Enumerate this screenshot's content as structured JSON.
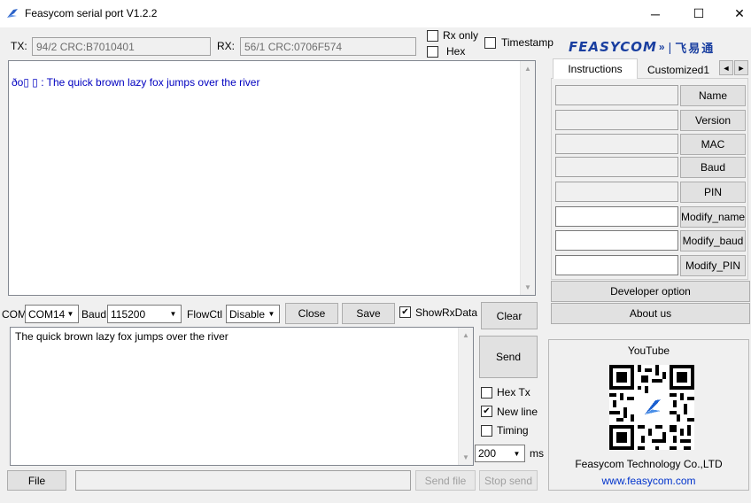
{
  "window": {
    "title": "Feasycom serial port V1.2.2",
    "minimize": "─",
    "maximize": "☐",
    "close": "✕"
  },
  "status": {
    "tx_label": "TX:",
    "tx_value": "94/2 CRC:B7010401",
    "rx_label": "RX:",
    "rx_value": "56/1 CRC:0706F574",
    "rx_only": "Rx only",
    "hex": "Hex",
    "timestamp": "Timestamp"
  },
  "logo": {
    "brand": "FEASYCOM",
    "chinese": "飞易通"
  },
  "receive": {
    "text": "ðo▯ ▯ : The quick brown lazy fox jumps over the river"
  },
  "controls": {
    "com_label": "COM",
    "com_value": "COM14",
    "baud_label": "Baud",
    "baud_value": "115200",
    "flowctl_label": "FlowCtl",
    "flowctl_value": "Disable",
    "close_btn": "Close",
    "save_btn": "Save",
    "show_rx_data": "ShowRxData",
    "clear_btn": "Clear"
  },
  "send": {
    "text": "The quick brown lazy fox jumps over the river",
    "send_btn": "Send",
    "hex_tx": "Hex Tx",
    "new_line": "New line",
    "timing": "Timing",
    "interval_value": "200",
    "ms_label": "ms"
  },
  "bottom": {
    "file_btn": "File",
    "send_file_btn": "Send file",
    "stop_send_btn": "Stop send"
  },
  "tabs": {
    "instructions": "Instructions",
    "customized": "Customized1",
    "left_arrow": "◄",
    "right_arrow": "►"
  },
  "side_buttons": {
    "name": "Name",
    "version": "Version",
    "mac": "MAC",
    "baud": "Baud",
    "pin": "PIN",
    "modify_name": "Modify_name",
    "modify_baud": "Modify_baud",
    "modify_pin": "Modify_PIN"
  },
  "side_actions": {
    "developer_option": "Developer option",
    "about_us": "About us"
  },
  "promo": {
    "youtube": "YouTube",
    "company": "Feasycom Technology Co.,LTD",
    "website": "www.feasycom.com"
  },
  "colors": {
    "received_text": "#0000c0",
    "logo_blue": "#1a3fa0",
    "link_blue": "#0033cc"
  }
}
